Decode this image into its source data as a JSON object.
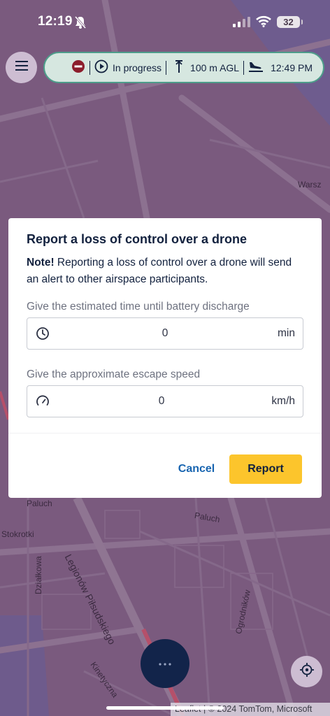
{
  "status_bar": {
    "time": "12:19",
    "battery": "32",
    "icons": [
      "bell-slash-icon",
      "signal-icon",
      "wifi-icon",
      "battery-icon"
    ]
  },
  "header": {
    "menu_icon": "hamburger-menu-icon",
    "flight_status": {
      "no_entry_icon": "no-entry-icon",
      "state_icon": "play-circle-icon",
      "state": "In progress",
      "altitude_icon": "altitude-icon",
      "altitude": "100 m AGL",
      "landing_icon": "landing-icon",
      "landing_time": "12:49 PM"
    }
  },
  "map": {
    "labels": {
      "warszawa": "Warsz",
      "paluch_left": "Paluch",
      "paluch_right": "Paluch",
      "stokrotki": "Stokrotki",
      "legionow": "Legionów Piłsudskiego",
      "dzialkowa": "Działkowa",
      "ogrodnikow": "Ogrodników",
      "kinetyczna": "Kinetyczna"
    },
    "attribution": "Leaflet | © 2024 TomTom, Microsoft",
    "colors": {
      "overlay": "#7a5a7e",
      "road": "#8a6f8d",
      "road_highlight": "#c0524a",
      "water": "#5c5a9a"
    }
  },
  "dialog": {
    "title": "Report a loss of control over a drone",
    "note_bold": "Note!",
    "note_text": " Reporting a loss of control over a drone will send an alert to other airspace participants.",
    "battery_field": {
      "label": "Give the estimated time until battery discharge",
      "icon": "clock-icon",
      "value": "0",
      "unit": "min"
    },
    "speed_field": {
      "label": "Give the approximate escape speed",
      "icon": "speedometer-icon",
      "value": "0",
      "unit": "km/h"
    },
    "cancel_label": "Cancel",
    "report_label": "Report",
    "colors": {
      "primary": "#fcc52c",
      "link": "#1764b0",
      "text": "#12213e"
    }
  },
  "footer": {
    "more_icon": "more-dots-icon",
    "locate_icon": "locate-crosshair-icon"
  }
}
